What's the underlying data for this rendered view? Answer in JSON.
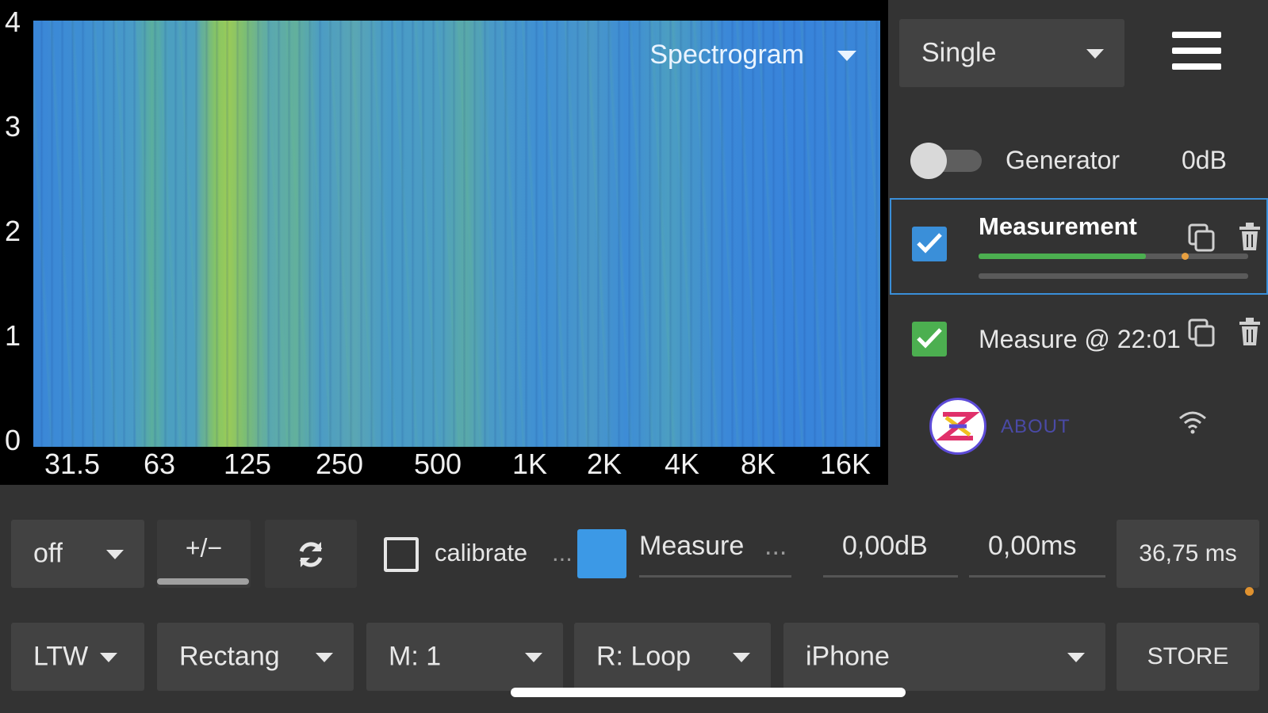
{
  "plot": {
    "title": "Spectrogram",
    "y_ticks": [
      "4",
      "3",
      "2",
      "1",
      "0"
    ],
    "x_ticks": [
      "31.5",
      "63",
      "125",
      "250",
      "500",
      "1K",
      "2K",
      "4K",
      "8K",
      "16K"
    ]
  },
  "top": {
    "mode": "Single"
  },
  "generator": {
    "label": "Generator",
    "level": "0dB",
    "enabled": false
  },
  "measurements": [
    {
      "title": "Measurement",
      "checked": true,
      "check_color": "#3a8fd9",
      "progress": 0.62
    },
    {
      "title": "Measure @ 22:01",
      "checked": true,
      "check_color": "#4caf50"
    }
  ],
  "about": {
    "label": "ABOUT"
  },
  "toolbar1": {
    "smoothing": "off",
    "invert": "+/−",
    "calibrate": "calibrate",
    "calibrate_more": "...",
    "trace_name": "Measure",
    "trace_more": "...",
    "gain": "0,00dB",
    "delay": "0,00ms",
    "duration": "36,75 ms"
  },
  "toolbar2": {
    "weighting": "LTW",
    "window": "Rectang",
    "mode": "M: 1",
    "repeat": "R: Loop",
    "device": "iPhone",
    "store": "STORE"
  },
  "colors": {
    "accent": "#3a8fd9",
    "green": "#4caf50",
    "swatch": "#3c99e6"
  }
}
